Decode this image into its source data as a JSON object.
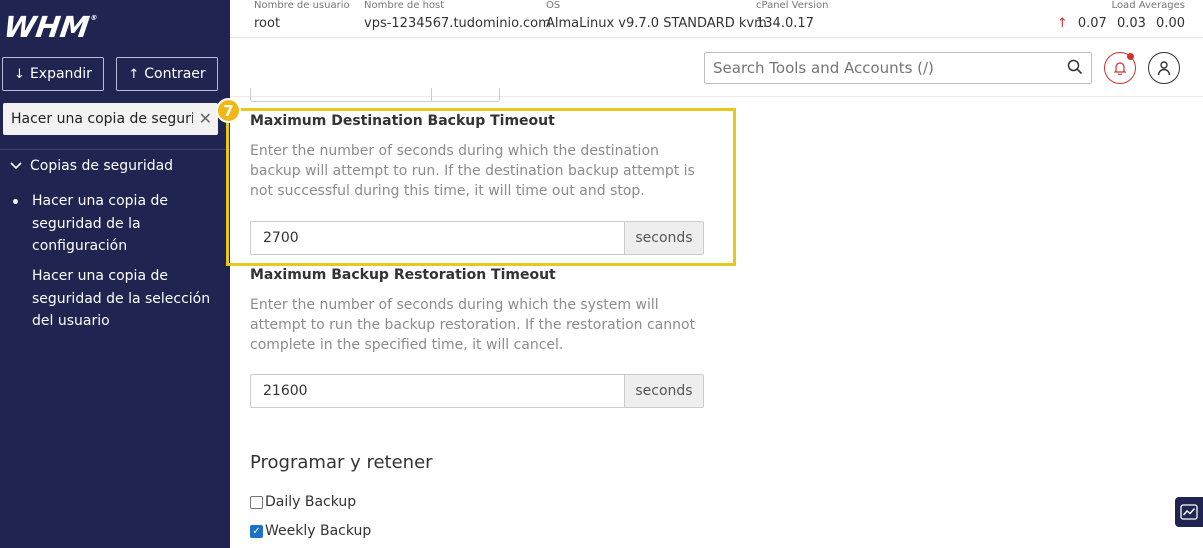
{
  "sidebar": {
    "logo": "WHM",
    "logo_mark": "®",
    "expand_label": "Expandir",
    "collapse_label": "Contraer",
    "search_value": "Hacer una copia de seguridad",
    "group_label": "Copias de seguridad",
    "items": [
      {
        "label": "Hacer una copia de seguridad de la configuración",
        "active": true
      },
      {
        "label": "Hacer una copia de seguridad de la selección del usuario",
        "active": false
      }
    ]
  },
  "topbar": {
    "username_label": "Nombre de usuario",
    "username": "root",
    "hostname_label": "Nombre de host",
    "hostname": "vps-1234567.tudominio.com",
    "os_label": "OS",
    "os": "AlmaLinux v9.7.0 STANDARD kvm",
    "cpanel_label": "cPanel Version",
    "cpanel_version": "134.0.17",
    "load_label": "Load Averages",
    "load_values": [
      "0.07",
      "0.03",
      "0.00"
    ]
  },
  "header": {
    "search_placeholder": "Search Tools and Accounts (/)"
  },
  "content": {
    "step_number": "7",
    "fields": [
      {
        "title": "Maximum Destination Backup Timeout",
        "description": "Enter the number of seconds during which the destination backup will attempt to run. If the destination backup attempt is not successful during this time, it will time out and stop.",
        "value": "2700",
        "unit": "seconds"
      },
      {
        "title": "Maximum Backup Restoration Timeout",
        "description": "Enter the number of seconds during which the system will attempt to run the backup restoration. If the restoration cannot complete in the specified time, it will cancel.",
        "value": "21600",
        "unit": "seconds"
      }
    ],
    "schedule_title": "Programar y retener",
    "checkboxes": [
      {
        "label": "Daily Backup",
        "checked": false
      },
      {
        "label": "Weekly Backup",
        "checked": true
      }
    ]
  },
  "colors": {
    "sidebar_bg": "#1f2450",
    "highlight": "#e7c821",
    "badge": "#f2b712",
    "alert": "#d0312d"
  }
}
